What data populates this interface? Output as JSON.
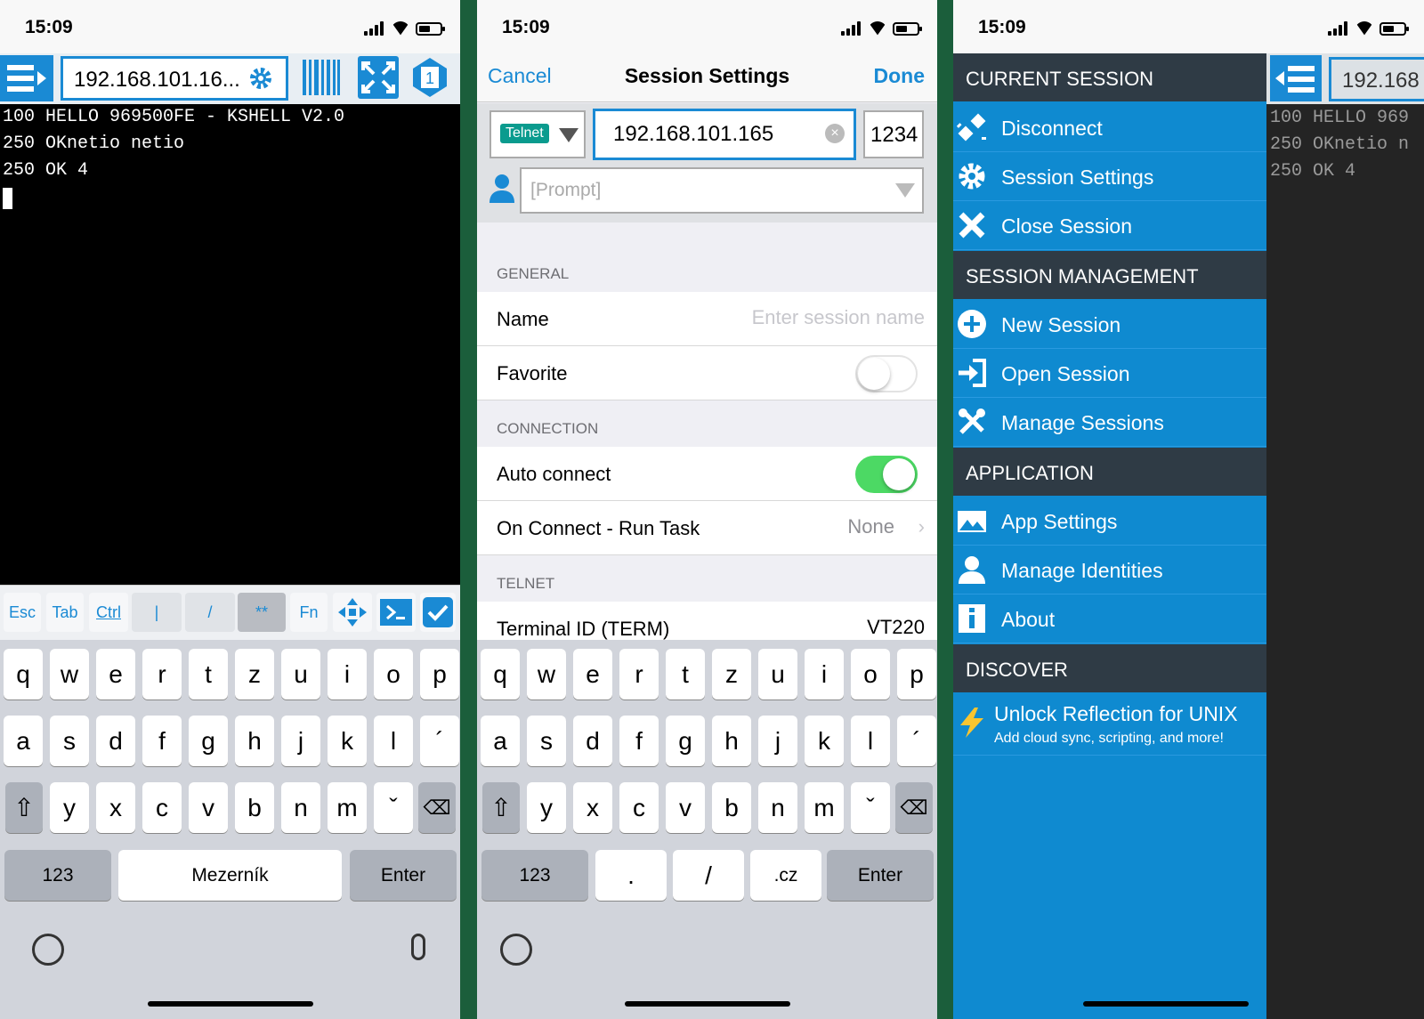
{
  "status": {
    "time": "15:09"
  },
  "terminal": {
    "host": "192.168.101.16...",
    "lines": [
      "100 HELLO 969500FE - KSHELL V2.0",
      "250 OKnetio netio",
      "250 OK 4"
    ],
    "accessory": {
      "esc": "Esc",
      "tab": "Tab",
      "ctrl": "Ctrl",
      "pipe": "|",
      "slash": "/",
      "stars": "**",
      "fn": "Fn"
    }
  },
  "keyboard": {
    "row1": [
      "q",
      "w",
      "e",
      "r",
      "t",
      "z",
      "u",
      "i",
      "o",
      "p"
    ],
    "row2": [
      "a",
      "s",
      "d",
      "f",
      "g",
      "h",
      "j",
      "k",
      "l",
      "´"
    ],
    "row3": [
      "y",
      "x",
      "c",
      "v",
      "b",
      "n",
      "m",
      "ˇ"
    ],
    "num": "123",
    "space": "Mezerník",
    "enter": "Enter",
    "url_keys": [
      ".",
      "/",
      ".cz"
    ]
  },
  "settings": {
    "cancel": "Cancel",
    "title": "Session Settings",
    "done": "Done",
    "protocol": "Telnet",
    "host": "192.168.101.165",
    "port": "1234",
    "prompt_placeholder": "[Prompt]",
    "general": "GENERAL",
    "name_label": "Name",
    "name_placeholder": "Enter session name",
    "favorite": "Favorite",
    "favorite_on": false,
    "connection": "CONNECTION",
    "autoconnect": "Auto connect",
    "autoconnect_on": true,
    "runtask": "On Connect - Run Task",
    "runtask_value": "None",
    "telnet": "TELNET",
    "termid": "Terminal ID (TERM)",
    "termid_value": "VT220"
  },
  "menu": {
    "current": "CURRENT SESSION",
    "disconnect": "Disconnect",
    "session_settings": "Session Settings",
    "close": "Close Session",
    "management": "SESSION MANAGEMENT",
    "new": "New Session",
    "open": "Open Session",
    "manage": "Manage Sessions",
    "application": "APPLICATION",
    "app_settings": "App Settings",
    "identities": "Manage Identities",
    "about": "About",
    "discover": "DISCOVER",
    "unlock": "Unlock Reflection for UNIX",
    "unlock_sub": "Add cloud sync, scripting, and more!",
    "bg_host": "192.168",
    "bg_lines": [
      "100 HELLO 969",
      "250 OKnetio n",
      "250 OK 4"
    ]
  },
  "colors": {
    "accent": "#1a8ad4",
    "drawer": "#0f8ad0",
    "header": "#2f3b45",
    "green": "#4cd964",
    "teal": "#0a9b8e"
  }
}
